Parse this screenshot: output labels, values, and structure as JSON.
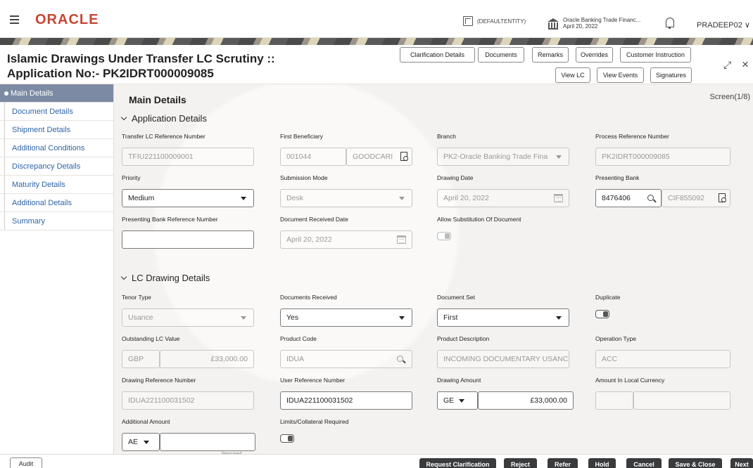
{
  "topbar": {
    "logo": "ORACLE",
    "entity": "(DEFAULTENTITY)",
    "branch_name": "Oracle Banking Trade Financ...",
    "branch_date": "April 20, 2022",
    "user": "PRADEEP02",
    "user_chevron": "∨"
  },
  "header": {
    "title": "Islamic Drawings Under Transfer LC Scrutiny :: Application No:- PK2IDRT000009085",
    "buttons": {
      "clarification": "Clarification Details",
      "documents": "Documents",
      "remarks": "Remarks",
      "overrides": "Overrides",
      "customer_instruction": "Customer Instruction",
      "view_lc": "View LC",
      "view_events": "View Events",
      "signatures": "Signatures"
    },
    "close_glyph": "×",
    "expand_glyph": "⤢"
  },
  "sidebar": {
    "items": [
      {
        "label": "Main Details"
      },
      {
        "label": "Document Details"
      },
      {
        "label": "Shipment Details"
      },
      {
        "label": "Additional Conditions"
      },
      {
        "label": "Discrepancy Details"
      },
      {
        "label": "Maturity Details"
      },
      {
        "label": "Additional Details"
      },
      {
        "label": "Summary"
      }
    ]
  },
  "main": {
    "title": "Main Details",
    "screen": "Screen(1/8)",
    "application_details": {
      "title": "Application Details",
      "transfer_lc_ref": {
        "label": "Transfer LC Reference Number",
        "value": "TFIU221100009001"
      },
      "first_beneficiary": {
        "label": "First Beneficiary",
        "id": "001044",
        "name": "GOODCARI"
      },
      "branch": {
        "label": "Branch",
        "value": "PK2-Oracle Banking Trade Fina"
      },
      "process_ref": {
        "label": "Process Reference Number",
        "value": "PK2IDRT000009085"
      },
      "priority": {
        "label": "Priority",
        "value": "Medium"
      },
      "submission_mode": {
        "label": "Submission Mode",
        "value": "Desk"
      },
      "drawing_date": {
        "label": "Drawing Date",
        "value": "April 20, 2022"
      },
      "presenting_bank": {
        "label": "Presenting Bank",
        "value": "8476406",
        "cif": "CIF855092"
      },
      "presenting_bank_ref": {
        "label": "Presenting Bank Reference Number",
        "value": ""
      },
      "doc_received_date": {
        "label": "Document Received Date",
        "value": "April 20, 2022"
      },
      "allow_substitution": {
        "label": "Allow Substitution Of Document"
      }
    },
    "lc_drawing_details": {
      "title": "LC Drawing Details",
      "tenor_type": {
        "label": "Tenor Type",
        "value": "Usance"
      },
      "documents_received": {
        "label": "Documents Received",
        "value": "Yes"
      },
      "document_set": {
        "label": "Document Set",
        "value": "First"
      },
      "duplicate": {
        "label": "Duplicate"
      },
      "outstanding_lc_value": {
        "label": "Outstanding LC Value",
        "currency": "GBP",
        "amount": "£33,000.00"
      },
      "product_code": {
        "label": "Product Code",
        "value": "IDUA"
      },
      "product_description": {
        "label": "Product Description",
        "value": "INCOMING DOCUMENTARY USANCE"
      },
      "operation_type": {
        "label": "Operation Type",
        "value": "ACC"
      },
      "drawing_ref": {
        "label": "Drawing Reference Number",
        "value": "IDUA221100031502"
      },
      "user_ref": {
        "label": "User Reference Number",
        "value": "IDUA221100031502"
      },
      "drawing_amount": {
        "label": "Drawing Amount",
        "currency": "GE",
        "amount": "£33,000.00"
      },
      "amount_local": {
        "label": "Amount In Local Currency",
        "currency": "",
        "amount": ""
      },
      "additional_amount": {
        "label": "Additional Amount",
        "currency": "AE",
        "amount": "",
        "required": "Required"
      },
      "limits_collateral": {
        "label": "Limits/Collateral Required"
      }
    }
  },
  "footer": {
    "audit": "Audit",
    "request_clarification": "Request Clarification",
    "reject": "Reject",
    "refer": "Refer",
    "hold": "Hold",
    "cancel": "Cancel",
    "save_close": "Save & Close",
    "next": "Next"
  }
}
